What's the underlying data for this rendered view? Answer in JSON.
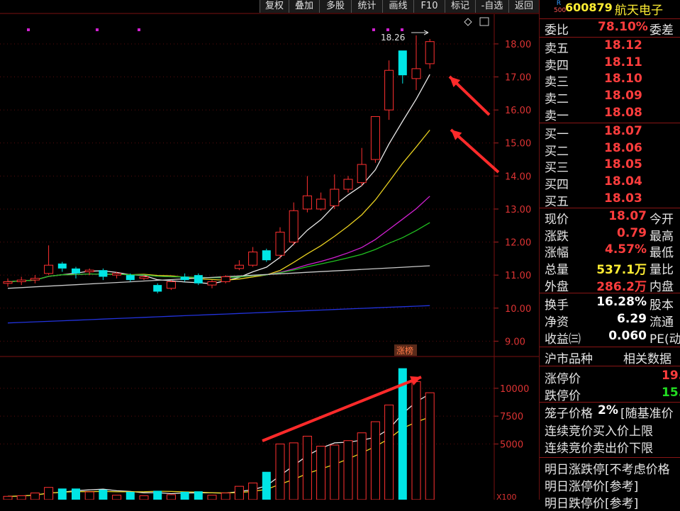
{
  "toolbar": {
    "buttons": [
      "复权",
      "叠加",
      "多股",
      "统计",
      "画线",
      "F10",
      "标记",
      "-自选",
      "返回"
    ]
  },
  "chart": {
    "price_ticks": [
      "18.00",
      "17.00",
      "16.00",
      "15.00",
      "14.00",
      "13.00",
      "12.00",
      "11.00",
      "10.00",
      "9.00"
    ],
    "volume_ticks": [
      "10000",
      "7500",
      "5000"
    ],
    "high_label": "18.26",
    "tag_label": "涨榜",
    "unit_label": "X100"
  },
  "chart_data": {
    "type": "candlestick",
    "price_range": [
      8.6,
      18.9
    ],
    "candles": [
      {
        "o": 10.75,
        "c": 10.8,
        "h": 10.9,
        "l": 10.65,
        "v": 300
      },
      {
        "o": 10.8,
        "c": 10.85,
        "h": 10.95,
        "l": 10.7,
        "v": 350
      },
      {
        "o": 10.85,
        "c": 10.9,
        "h": 11.0,
        "l": 10.75,
        "v": 600
      },
      {
        "o": 11.05,
        "c": 11.3,
        "h": 11.9,
        "l": 11.0,
        "v": 1100
      },
      {
        "o": 11.35,
        "c": 11.2,
        "h": 11.4,
        "l": 11.1,
        "v": 1000
      },
      {
        "o": 11.2,
        "c": 11.05,
        "h": 11.25,
        "l": 10.9,
        "v": 1000
      },
      {
        "o": 11.1,
        "c": 11.15,
        "h": 11.2,
        "l": 11.0,
        "v": 700
      },
      {
        "o": 11.15,
        "c": 10.95,
        "h": 11.2,
        "l": 10.85,
        "v": 900
      },
      {
        "o": 11.0,
        "c": 11.05,
        "h": 11.1,
        "l": 10.9,
        "v": 400
      },
      {
        "o": 11.0,
        "c": 10.85,
        "h": 11.05,
        "l": 10.8,
        "v": 700
      },
      {
        "o": 10.9,
        "c": 10.95,
        "h": 11.0,
        "l": 10.85,
        "v": 350
      },
      {
        "o": 10.7,
        "c": 10.5,
        "h": 10.75,
        "l": 10.45,
        "v": 800
      },
      {
        "o": 10.6,
        "c": 10.8,
        "h": 10.85,
        "l": 10.55,
        "v": 450
      },
      {
        "o": 10.95,
        "c": 10.85,
        "h": 11.05,
        "l": 10.8,
        "v": 700
      },
      {
        "o": 11.0,
        "c": 10.75,
        "h": 11.05,
        "l": 10.7,
        "v": 750
      },
      {
        "o": 10.7,
        "c": 10.8,
        "h": 10.85,
        "l": 10.6,
        "v": 400
      },
      {
        "o": 10.8,
        "c": 10.95,
        "h": 11.0,
        "l": 10.75,
        "v": 600
      },
      {
        "o": 11.2,
        "c": 11.3,
        "h": 11.45,
        "l": 11.15,
        "v": 1200
      },
      {
        "o": 11.3,
        "c": 11.7,
        "h": 11.85,
        "l": 11.25,
        "v": 1500
      },
      {
        "o": 11.75,
        "c": 11.45,
        "h": 11.8,
        "l": 11.4,
        "v": 2500
      },
      {
        "o": 11.6,
        "c": 12.3,
        "h": 12.45,
        "l": 11.5,
        "v": 5000
      },
      {
        "o": 12.0,
        "c": 12.95,
        "h": 13.2,
        "l": 11.9,
        "v": 5100
      },
      {
        "o": 13.0,
        "c": 13.4,
        "h": 14.0,
        "l": 12.9,
        "v": 5700
      },
      {
        "o": 13.0,
        "c": 13.3,
        "h": 13.5,
        "l": 12.95,
        "v": 4800
      },
      {
        "o": 13.1,
        "c": 13.6,
        "h": 14.05,
        "l": 13.0,
        "v": 4900
      },
      {
        "o": 13.6,
        "c": 13.9,
        "h": 14.0,
        "l": 13.5,
        "v": 5300
      },
      {
        "o": 13.8,
        "c": 14.35,
        "h": 14.85,
        "l": 13.7,
        "v": 6000
      },
      {
        "o": 14.5,
        "c": 15.8,
        "h": 15.8,
        "l": 14.4,
        "v": 7000
      },
      {
        "o": 16.0,
        "c": 17.2,
        "h": 17.5,
        "l": 15.7,
        "v": 8500
      },
      {
        "o": 17.8,
        "c": 17.05,
        "h": 17.8,
        "l": 16.8,
        "v": 11800
      },
      {
        "o": 16.95,
        "c": 17.25,
        "h": 18.26,
        "l": 16.6,
        "v": 10600
      },
      {
        "o": 17.4,
        "c": 18.07,
        "h": 18.15,
        "l": 17.25,
        "v": 9600
      }
    ]
  },
  "quote": {
    "rank": "R",
    "rank_sub": "500",
    "code": "600879",
    "name": "航天电子",
    "weibi_label": "委比",
    "weibi_value": "78.10%",
    "weicha_label": "委差",
    "asks": [
      {
        "label": "卖五",
        "price": "18.12"
      },
      {
        "label": "卖四",
        "price": "18.11"
      },
      {
        "label": "卖三",
        "price": "18.10"
      },
      {
        "label": "卖二",
        "price": "18.09"
      },
      {
        "label": "卖一",
        "price": "18.08"
      }
    ],
    "bids": [
      {
        "label": "买一",
        "price": "18.07"
      },
      {
        "label": "买二",
        "price": "18.06"
      },
      {
        "label": "买三",
        "price": "18.05"
      },
      {
        "label": "买四",
        "price": "18.04"
      },
      {
        "label": "买五",
        "price": "18.03"
      }
    ],
    "stats": [
      {
        "label": "现价",
        "value": "18.07",
        "cls": "red",
        "right": "今开"
      },
      {
        "label": "涨跌",
        "value": "0.79",
        "cls": "red",
        "right": "最高"
      },
      {
        "label": "涨幅",
        "value": "4.57%",
        "cls": "red",
        "right": "最低"
      },
      {
        "label": "总量",
        "value": "537.1万",
        "cls": "yel",
        "right": "量比"
      },
      {
        "label": "外盘",
        "value": "286.2万",
        "cls": "red",
        "right": "内盘"
      }
    ],
    "stats2": [
      {
        "label": "换手",
        "value": "16.28%",
        "cls": "wht",
        "right": "股本"
      },
      {
        "label": "净资",
        "value": "6.29",
        "cls": "wht",
        "right": "流通"
      },
      {
        "label": "收益㈢",
        "value": "0.060",
        "cls": "wht",
        "right": "PE(动"
      }
    ],
    "tab_left": "沪市品种",
    "tab_right": "相关数据",
    "limit_up_label": "涨停价",
    "limit_up_value": "19.",
    "limit_down_label": "跌停价",
    "limit_down_value": "15.",
    "cage_label": "笼子价格",
    "cage_pct": "2%",
    "cage_rest": "[随基准价",
    "buy_limit": "连续竞价买入价上限",
    "sell_limit": "连续竞价卖出价下限",
    "tomorrow_1": "明日涨跌停[不考虑价格",
    "tomorrow_2": "明日涨停价[参考]",
    "tomorrow_3": "明日跌停价[参考]"
  }
}
